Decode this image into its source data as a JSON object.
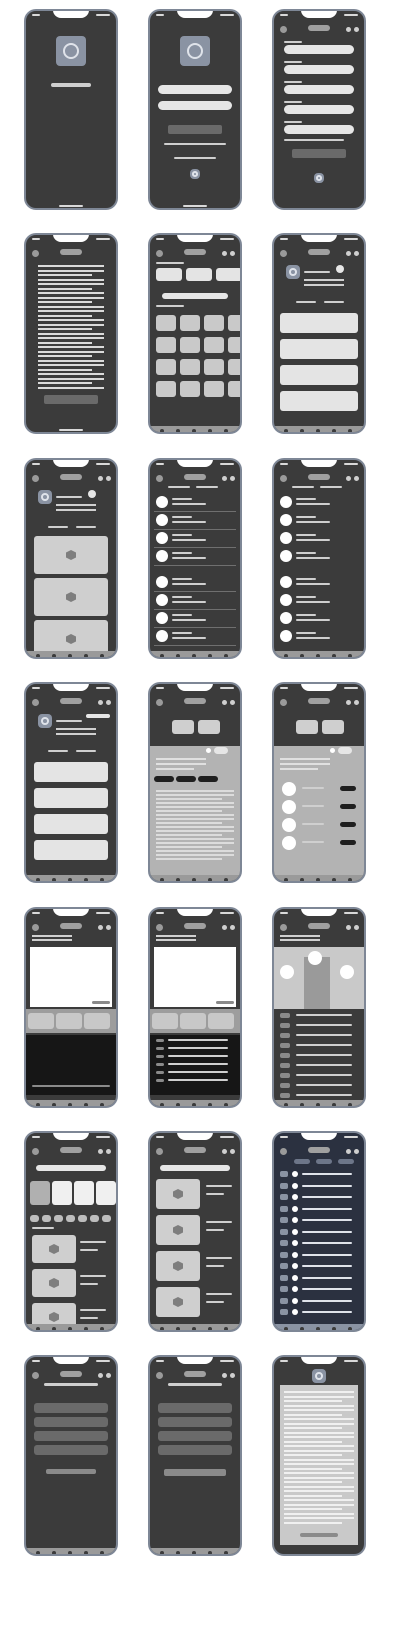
{
  "board": {
    "title": "",
    "rows": 7,
    "columns": 3
  },
  "screens": [
    {
      "id": "splash",
      "label": ""
    },
    {
      "id": "login",
      "label": ""
    },
    {
      "id": "signup-form",
      "label": ""
    },
    {
      "id": "terms-text",
      "label": ""
    },
    {
      "id": "catalog-grid",
      "label": ""
    },
    {
      "id": "profile-list",
      "label": ""
    },
    {
      "id": "profile-gallery",
      "label": ""
    },
    {
      "id": "contacts-list",
      "label": ""
    },
    {
      "id": "contacts-list-alt",
      "label": ""
    },
    {
      "id": "profile-list-alt",
      "label": ""
    },
    {
      "id": "detail-sheet",
      "label": ""
    },
    {
      "id": "detail-sheet-list",
      "label": ""
    },
    {
      "id": "video-player",
      "label": ""
    },
    {
      "id": "video-player-list",
      "label": ""
    },
    {
      "id": "map-pins",
      "label": ""
    },
    {
      "id": "shop-home",
      "label": ""
    },
    {
      "id": "shop-results",
      "label": ""
    },
    {
      "id": "dark-list",
      "label": ""
    },
    {
      "id": "settings-menu",
      "label": ""
    },
    {
      "id": "settings-menu-alt",
      "label": ""
    },
    {
      "id": "article-modal",
      "label": ""
    }
  ],
  "colors": {
    "phone_body": "#3b3b3b",
    "phone_frame": "#7e8796",
    "placeholder_light": "#e4e4e4",
    "panel_grey": "#b3b3b3",
    "navy_screen": "#2b3140"
  }
}
